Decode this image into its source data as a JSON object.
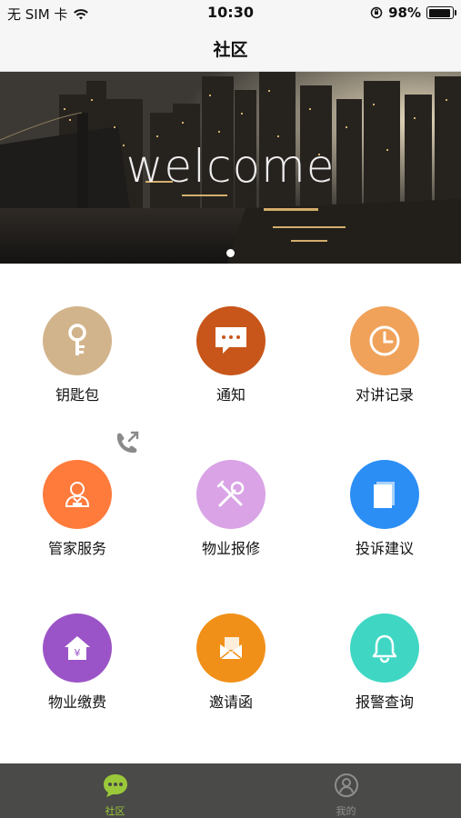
{
  "status_bar": {
    "carrier": "无 SIM 卡",
    "time": "10:30",
    "battery_percent": "98%",
    "battery_level": 0.98
  },
  "nav": {
    "title": "社区"
  },
  "banner": {
    "text": "welcome",
    "dots": 1
  },
  "grid": [
    {
      "label": "钥匙包",
      "icon": "key-icon",
      "color": "#d2b48c"
    },
    {
      "label": "通知",
      "icon": "message-icon",
      "color": "#c8561a"
    },
    {
      "label": "对讲记录",
      "icon": "clock-icon",
      "color": "#f0a25a"
    },
    {
      "label": "管家服务",
      "icon": "butler-icon",
      "color": "#ff7b3b"
    },
    {
      "label": "物业报修",
      "icon": "tools-icon",
      "color": "#d9a3e6"
    },
    {
      "label": "投诉建议",
      "icon": "document-icon",
      "color": "#2b8ef5"
    },
    {
      "label": "物业缴费",
      "icon": "house-payment-icon",
      "color": "#9b54c7"
    },
    {
      "label": "邀请函",
      "icon": "envelope-icon",
      "color": "#f09018"
    },
    {
      "label": "报警查询",
      "icon": "bell-icon",
      "color": "#3fd7c4"
    }
  ],
  "tabs": [
    {
      "label": "社区",
      "icon": "chat-bubble-icon",
      "active": true,
      "color": "#9bc83a"
    },
    {
      "label": "我的",
      "icon": "profile-icon",
      "active": false,
      "color": "#8e8e8e"
    }
  ]
}
